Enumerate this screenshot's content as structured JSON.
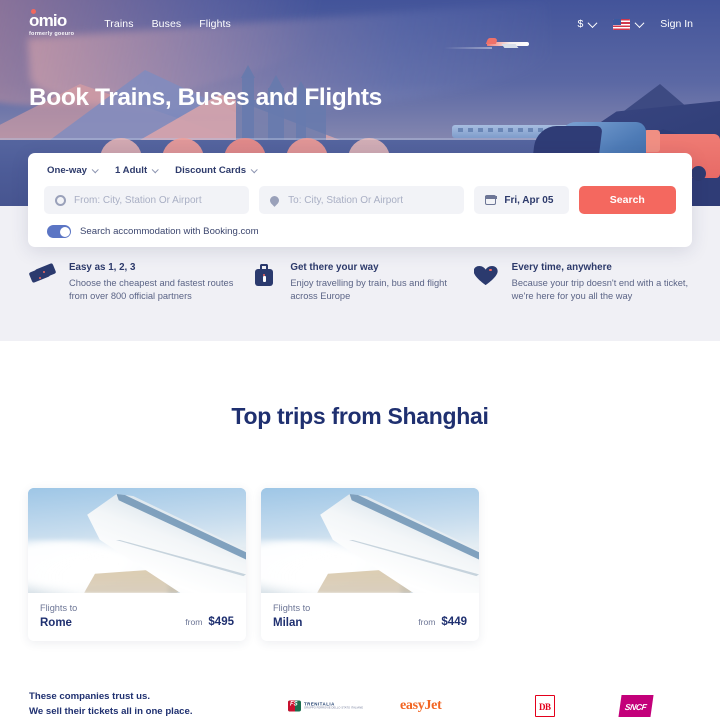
{
  "nav": {
    "logo": {
      "word": "omio",
      "sub_prefix": "formerly ",
      "sub_brand": "goeuro",
      "dot": "logo-dot"
    },
    "links": [
      {
        "label": "Trains",
        "name": "nav-link-trains"
      },
      {
        "label": "Buses",
        "name": "nav-link-buses"
      },
      {
        "label": "Flights",
        "name": "nav-link-flights"
      }
    ],
    "currency": "$",
    "flag": "us-flag-icon",
    "signin": "Sign In"
  },
  "hero": {
    "title": "Book Trains, Buses and Flights"
  },
  "search": {
    "options": [
      {
        "label": "One-way",
        "name": "trip-type-selector"
      },
      {
        "label": "1 Adult",
        "name": "passenger-selector"
      },
      {
        "label": "Discount Cards",
        "name": "discount-cards-selector"
      }
    ],
    "from_placeholder": "From: City, Station Or Airport",
    "to_placeholder": "To: City, Station Or Airport",
    "date_value": "Fri, Apr 05",
    "search_label": "Search",
    "toggle_label": "Search accommodation with Booking.com",
    "toggle_on": true,
    "accent_color": "#f4685f"
  },
  "features": [
    {
      "icon": "ticket-icon",
      "title": "Easy as 1, 2, 3",
      "desc": "Choose the cheapest and fastest routes from over 800 official partners"
    },
    {
      "icon": "suitcase-icon",
      "title": "Get there your way",
      "desc": "Enjoy travelling by train, bus and flight across Europe"
    },
    {
      "icon": "heart-icon",
      "title": "Every time, anywhere",
      "desc": "Because your trip doesn't end with a ticket, we're here for you all the way"
    }
  ],
  "trips": {
    "title": "Top trips from Shanghai",
    "cards": [
      {
        "kicker": "Flights to",
        "city": "Rome",
        "from": "from",
        "price": "$495",
        "image": "airplane-wing-photo"
      },
      {
        "kicker": "Flights to",
        "city": "Milan",
        "from": "from",
        "price": "$449",
        "image": "airplane-wing-photo"
      }
    ]
  },
  "partners": {
    "line1": "These companies trust us.",
    "line2": "We sell their tickets all in one place.",
    "logos": [
      {
        "name": "trenitalia-logo",
        "title": "TRENITALIA",
        "subtitle": "GRUPPO FERROVIE DELLO STATO ITALIANE"
      },
      {
        "name": "easyjet-logo",
        "text": "easyJet",
        "color": "#f26522"
      },
      {
        "name": "db-logo",
        "text": "DB",
        "color": "#e3001b"
      },
      {
        "name": "sncf-logo",
        "text": "SNCF",
        "color": "#c3007a"
      }
    ]
  },
  "colors": {
    "brand_navy": "#1f3070",
    "accent_red": "#f4685f",
    "hero_blue": "#4a5d9e",
    "section_gray": "#f0f0f5"
  }
}
